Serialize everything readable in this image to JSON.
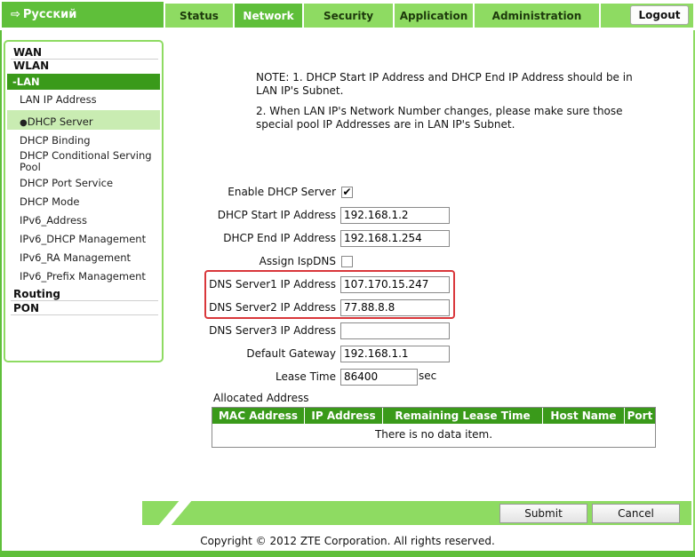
{
  "header": {
    "language": "Русский",
    "tabs": [
      {
        "label": "Status"
      },
      {
        "label": "Network"
      },
      {
        "label": "Security"
      },
      {
        "label": "Application"
      },
      {
        "label": "Administration"
      }
    ],
    "logout_label": "Logout"
  },
  "sidebar": {
    "wan": "WAN",
    "wlan": "WLAN",
    "lan": "-LAN",
    "lan_items": [
      "LAN IP Address",
      "DHCP Server",
      "DHCP Binding",
      "DHCP Conditional Serving Pool",
      "DHCP Port Service",
      "DHCP Mode",
      "IPv6_Address",
      "IPv6_DHCP Management",
      "IPv6_RA Management",
      "IPv6_Prefix Management"
    ],
    "routing": "Routing",
    "pon": "PON"
  },
  "notes": {
    "line1": "NOTE:  1. DHCP Start IP Address and DHCP End IP Address should be in LAN IP's Subnet.",
    "line2": "2. When LAN IP's Network Number changes, please make sure those special pool IP Addresses are in LAN IP's Subnet."
  },
  "form": {
    "enable_dhcp_label": "Enable DHCP Server",
    "enable_dhcp_checked": true,
    "start_ip_label": "DHCP Start IP Address",
    "start_ip": "192.168.1.2",
    "end_ip_label": "DHCP End IP Address",
    "end_ip": "192.168.1.254",
    "assign_isp_dns_label": "Assign IspDNS",
    "assign_isp_dns_checked": false,
    "dns1_label": "DNS Server1 IP Address",
    "dns1": "107.170.15.247",
    "dns2_label": "DNS Server2 IP Address",
    "dns2": "77.88.8.8",
    "dns3_label": "DNS Server3 IP Address",
    "dns3": "",
    "gateway_label": "Default Gateway",
    "gateway": "192.168.1.1",
    "lease_label": "Lease Time",
    "lease": "86400",
    "lease_unit": "sec"
  },
  "allocated": {
    "title": "Allocated Address",
    "columns": [
      "MAC Address",
      "IP Address",
      "Remaining Lease Time",
      "Host Name",
      "Port"
    ],
    "empty_message": "There is no data item."
  },
  "footer": {
    "submit_label": "Submit",
    "cancel_label": "Cancel",
    "copyright": "Copyright © 2012 ZTE Corporation. All rights reserved."
  },
  "colors": {
    "brand_green": "#5fbf3a",
    "light_green": "#8edb62",
    "dark_green": "#3a9a1a",
    "highlight_red": "#d9373b"
  },
  "icons": {
    "language": "arrow-right-icon",
    "selected_bullet": "bullet-icon",
    "check": "checkmark-icon"
  }
}
